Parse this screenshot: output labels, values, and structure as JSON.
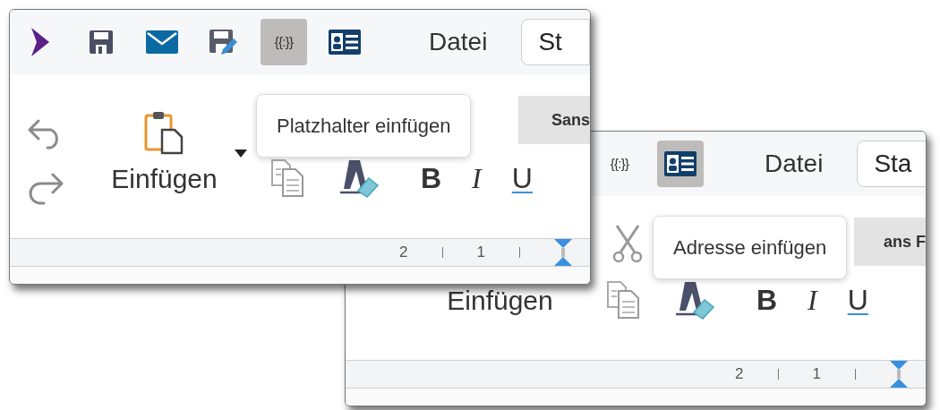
{
  "panels": [
    {
      "toolbar": {
        "items": [
          {
            "kind": "logo",
            "selected": false
          },
          {
            "kind": "save",
            "selected": false
          },
          {
            "kind": "mail",
            "selected": false
          },
          {
            "kind": "save-edit",
            "selected": false
          },
          {
            "kind": "placeholder",
            "label": "{{:}}",
            "selected": true
          },
          {
            "kind": "address-card",
            "selected": false
          }
        ],
        "menu": "Datei",
        "style_button": "St"
      },
      "ribbon": {
        "items": [
          {
            "kind": "undo"
          },
          {
            "kind": "redo"
          },
          {
            "kind": "paste-icon"
          },
          {
            "kind": "paste-label",
            "label": "Einfügen"
          },
          {
            "kind": "caret"
          },
          {
            "kind": "copy"
          },
          {
            "kind": "clear-format"
          }
        ],
        "font_box": "Sans",
        "format_buttons": [
          "B",
          "I",
          "U"
        ]
      },
      "tooltip": "Platzhalter einfügen",
      "ruler": [
        "2",
        "1"
      ]
    },
    {
      "toolbar": {
        "items": [
          {
            "kind": "placeholder",
            "label": "{{:}}",
            "selected": false
          },
          {
            "kind": "address-card",
            "selected": true
          }
        ],
        "menu": "Datei",
        "style_button": "Sta"
      },
      "ribbon": {
        "items": [
          {
            "kind": "paste-label",
            "label": "Einfügen"
          },
          {
            "kind": "cut"
          },
          {
            "kind": "copy"
          },
          {
            "kind": "clear-format"
          }
        ],
        "font_box": "ans F",
        "format_buttons": [
          "B",
          "I",
          "U"
        ]
      },
      "tooltip": "Adresse einfügen",
      "ruler": [
        "2",
        "1"
      ]
    }
  ]
}
